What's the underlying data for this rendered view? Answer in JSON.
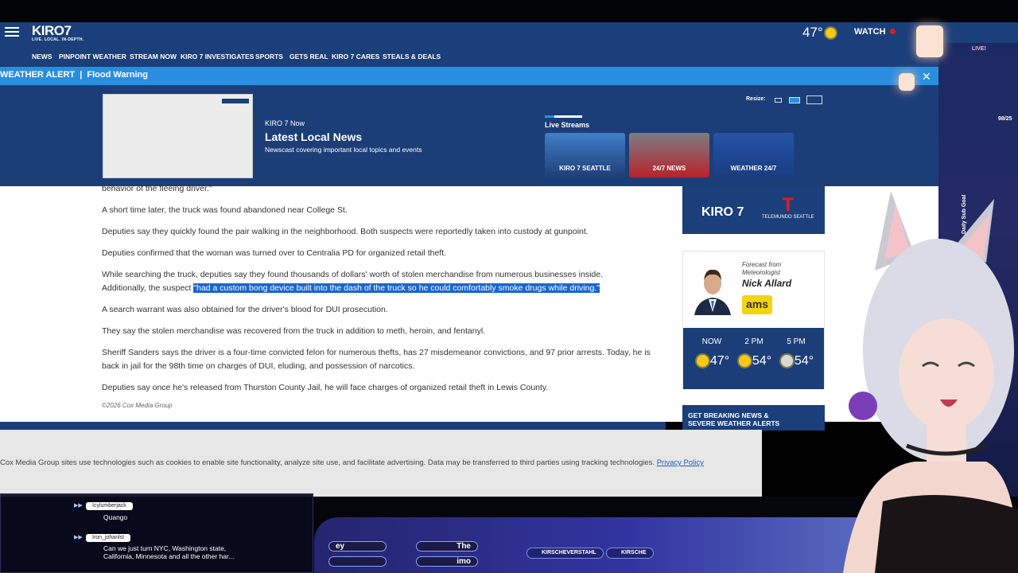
{
  "header": {
    "logo": "KIRO7",
    "logo_tagline": "LIVE. LOCAL. IN-DEPTH.",
    "temperature": "47°",
    "watch_label": "WATCH"
  },
  "nav": {
    "items": [
      "NEWS",
      "PINPOINT WEATHER",
      "STREAM NOW",
      "KIRO 7 INVESTIGATES",
      "SPORTS",
      "GETS REAL",
      "KIRO 7 CARES",
      "STEALS & DEALS"
    ]
  },
  "alert": {
    "text": "WEATHER ALERT  |  Flood Warning"
  },
  "player": {
    "now_label": "KIRO 7 Now",
    "title": "Latest Local News",
    "description": "Newscast covering important local topics and events",
    "resize_label": "Resize:",
    "live_streams_label": "Live Streams",
    "streams": [
      "KIRO 7 SEATTLE",
      "24/7 NEWS",
      "WEATHER 24/7"
    ]
  },
  "article": {
    "paragraphs": [
      "behavior of the fleeing driver.\"",
      "A short time later, the truck was found abandoned near College St.",
      "Deputies say they quickly found the pair walking in the neighborhood. Both suspects were reportedly taken into custody at gunpoint.",
      "Deputies confirmed that the woman was turned over to Centralia PD for organized retail theft.",
      "While searching the truck, deputies say they found thousands of dollars' worth of stolen merchandise from numerous businesses inside.",
      "A search warrant was also obtained for the driver's blood for DUI prosecution.",
      "They say the stolen merchandise was recovered from the truck in addition to meth, heroin, and fentanyl.",
      "Sheriff Sanders says the driver is a four-time convicted felon for numerous thefts, has 27 misdemeanor convictions, and 97 prior arrests. Today, he is",
      "back in jail for the 98th time on charges of DUI, eluding, and possession of narcotics.",
      "Deputies say once he's released from Thurston County Jail, he will face charges of organized retail theft in Lewis County."
    ],
    "line_additionally": "Additionally, the suspect ",
    "highlighted_quote": "\"had a custom bong device built into the dash of the truck so he could comfortably smoke drugs while driving.\"",
    "copyright": "©2026 Cox Media Group"
  },
  "sidebar": {
    "ad_logo": "KIRO 7",
    "ad_partner": "TELEMUNDO SEATTLE",
    "forecast_from": "Forecast from Meteorologist",
    "meteorologist": "Nick Allard",
    "sponsor": "ams",
    "forecast": [
      {
        "time": "NOW",
        "temp": "47°"
      },
      {
        "time": "2 PM",
        "temp": "54°"
      },
      {
        "time": "5 PM",
        "temp": "54°"
      }
    ],
    "breaking": "GET BREAKING NEWS & SEVERE WEATHER ALERTS"
  },
  "cookie": {
    "text": "Cox Media Group sites use technologies such as cookies to enable site functionality, analyze site use, and facilitate advertising. Data may be transferred to third parties using tracking technologies.",
    "link": "Privacy Policy"
  },
  "stream_overlay": {
    "chat": [
      {
        "user": "Icylumberjack",
        "message": "Quango"
      },
      {
        "user": "Iron_johanlst",
        "message": "Can we just turn NYC, Washington state, California, Minnesota and all the other har..."
      }
    ],
    "pills": [
      "ey",
      "The",
      "",
      "imo"
    ],
    "socials": [
      "KIRSCHEVERSTAHL",
      "KIRSCHE"
    ],
    "sub_goal": "Daily Sub Goal",
    "sub_progress": "98/25",
    "live_tag": "LIVE!"
  }
}
